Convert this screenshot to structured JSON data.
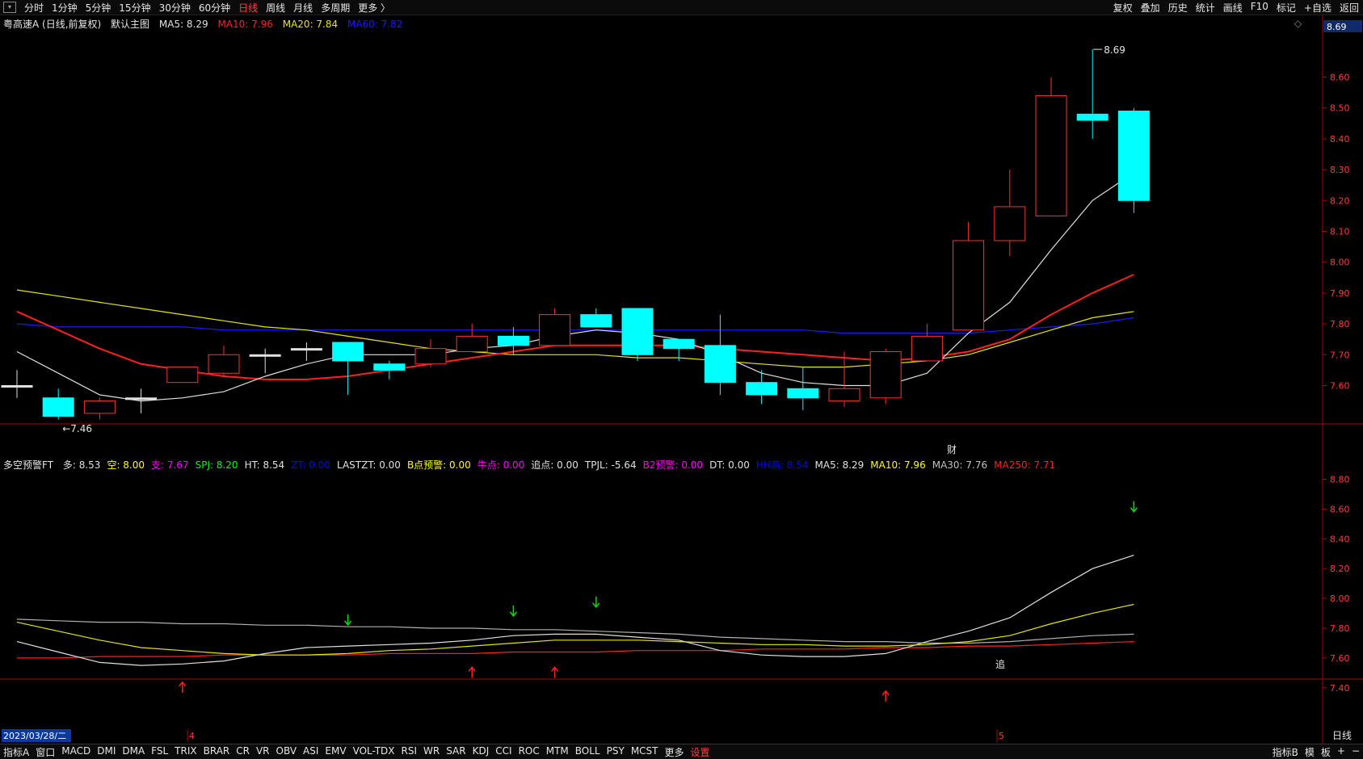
{
  "top_tabs": [
    "分时",
    "1分钟",
    "5分钟",
    "15分钟",
    "30分钟",
    "60分钟",
    "日线",
    "周线",
    "月线",
    "多周期",
    "更多 〉"
  ],
  "active_tab": "日线",
  "top_right": [
    "复权",
    "叠加",
    "历史",
    "统计",
    "画线",
    "F10",
    "标记",
    "+自选",
    "返回"
  ],
  "main_info": {
    "title": "粤高速A (日线,前复权)",
    "template": "默认主图",
    "ma5": "MA5: 8.29",
    "ma10": "MA10: 7.96",
    "ma20": "MA20: 7.84",
    "ma60": "MA60: 7.82"
  },
  "sub_info": {
    "name": "多空预警FT",
    "items": [
      {
        "t": "多: 8.53",
        "c": "#e0e0e0"
      },
      {
        "t": "空: 8.00",
        "c": "#ffff00"
      },
      {
        "t": "支: 7.67",
        "c": "#ff00ff"
      },
      {
        "t": "SPJ: 8.20",
        "c": "#00ff00"
      },
      {
        "t": "HT: 8.54",
        "c": "#e0e0e0"
      },
      {
        "t": "ZT: 0.00",
        "c": "#0000ff"
      },
      {
        "t": "LASTZT: 0.00",
        "c": "#e0e0e0"
      },
      {
        "t": "B点预警: 0.00",
        "c": "#ffff00"
      },
      {
        "t": "牛点: 0.00",
        "c": "#ff00ff"
      },
      {
        "t": "追点: 0.00",
        "c": "#e0e0e0"
      },
      {
        "t": "TPJL: -5.64",
        "c": "#e0e0e0"
      },
      {
        "t": "B2预警: 0.00",
        "c": "#ff00ff"
      },
      {
        "t": "DT: 0.00",
        "c": "#e0e0e0"
      },
      {
        "t": "HH高: 8.54",
        "c": "#0000ff"
      },
      {
        "t": "MA5: 8.29",
        "c": "#e0e0e0"
      },
      {
        "t": "MA10: 7.96",
        "c": "#ffff00"
      },
      {
        "t": "MA30: 7.76",
        "c": "#c0c0c0"
      },
      {
        "t": "MA250: 7.71",
        "c": "#ff2020"
      }
    ]
  },
  "labels": {
    "max": "8.69",
    "min": "7.46",
    "cai": "财",
    "zhui": "追",
    "date": "2023/03/28/二",
    "month4": "4",
    "month5": "5",
    "period": "日线",
    "price_current": "8.69"
  },
  "y_main_ticks": [
    "8.60",
    "8.50",
    "8.40",
    "8.30",
    "8.20",
    "8.10",
    "8.00",
    "7.90",
    "7.80",
    "7.70",
    "7.60"
  ],
  "y_sub_ticks": [
    "8.80",
    "8.60",
    "8.40",
    "8.20",
    "8.00",
    "7.80",
    "7.60",
    "7.40"
  ],
  "bottom_tabs": [
    "指标A",
    "窗口",
    "MACD",
    "DMI",
    "DMA",
    "FSL",
    "TRIX",
    "BRAR",
    "CR",
    "VR",
    "OBV",
    "ASI",
    "EMV",
    "VOL-TDX",
    "RSI",
    "WR",
    "SAR",
    "KDJ",
    "CCI",
    "ROC",
    "MTM",
    "BOLL",
    "PSY",
    "MCST",
    "更多",
    "设置"
  ],
  "bottom_right": [
    "指标B",
    "模",
    "板",
    "+",
    "−"
  ],
  "colors": {
    "up": "#ff3030",
    "down": "#00ffff",
    "ma5": "#e0e0e0",
    "ma10": "#ff2020",
    "ma20": "#e6e600",
    "ma60": "#1a1aff"
  },
  "chart_data": {
    "type": "candlestick",
    "candles": [
      {
        "o": 7.6,
        "h": 7.65,
        "l": 7.56,
        "c": 7.6
      },
      {
        "o": 7.56,
        "h": 7.59,
        "l": 7.49,
        "c": 7.5
      },
      {
        "o": 7.51,
        "h": 7.56,
        "l": 7.49,
        "c": 7.55
      },
      {
        "o": 7.56,
        "h": 7.59,
        "l": 7.51,
        "c": 7.56
      },
      {
        "o": 7.61,
        "h": 7.66,
        "l": 7.61,
        "c": 7.66
      },
      {
        "o": 7.64,
        "h": 7.73,
        "l": 7.63,
        "c": 7.7
      },
      {
        "o": 7.7,
        "h": 7.72,
        "l": 7.64,
        "c": 7.7
      },
      {
        "o": 7.72,
        "h": 7.74,
        "l": 7.68,
        "c": 7.72
      },
      {
        "o": 7.74,
        "h": 7.74,
        "l": 7.57,
        "c": 7.68
      },
      {
        "o": 7.67,
        "h": 7.68,
        "l": 7.62,
        "c": 7.65
      },
      {
        "o": 7.67,
        "h": 7.75,
        "l": 7.66,
        "c": 7.72
      },
      {
        "o": 7.71,
        "h": 7.8,
        "l": 7.71,
        "c": 7.76
      },
      {
        "o": 7.76,
        "h": 7.79,
        "l": 7.7,
        "c": 7.73
      },
      {
        "o": 7.73,
        "h": 7.85,
        "l": 7.73,
        "c": 7.83
      },
      {
        "o": 7.83,
        "h": 7.85,
        "l": 7.79,
        "c": 7.79
      },
      {
        "o": 7.85,
        "h": 7.85,
        "l": 7.68,
        "c": 7.7
      },
      {
        "o": 7.75,
        "h": 7.75,
        "l": 7.68,
        "c": 7.72
      },
      {
        "o": 7.73,
        "h": 7.83,
        "l": 7.57,
        "c": 7.61
      },
      {
        "o": 7.61,
        "h": 7.65,
        "l": 7.54,
        "c": 7.57
      },
      {
        "o": 7.59,
        "h": 7.66,
        "l": 7.52,
        "c": 7.56
      },
      {
        "o": 7.55,
        "h": 7.71,
        "l": 7.53,
        "c": 7.59
      },
      {
        "o": 7.56,
        "h": 7.72,
        "l": 7.54,
        "c": 7.71
      },
      {
        "o": 7.68,
        "h": 7.8,
        "l": 7.68,
        "c": 7.76
      },
      {
        "o": 7.78,
        "h": 8.13,
        "l": 7.78,
        "c": 8.07
      },
      {
        "o": 8.07,
        "h": 8.3,
        "l": 8.02,
        "c": 8.18
      },
      {
        "o": 8.15,
        "h": 8.6,
        "l": 8.15,
        "c": 8.54
      },
      {
        "o": 8.48,
        "h": 8.69,
        "l": 8.4,
        "c": 8.46
      },
      {
        "o": 8.49,
        "h": 8.5,
        "l": 8.16,
        "c": 8.2
      }
    ],
    "ma5": [
      7.71,
      7.64,
      7.57,
      7.55,
      7.56,
      7.58,
      7.63,
      7.67,
      7.7,
      7.7,
      7.7,
      7.72,
      7.73,
      7.76,
      7.78,
      7.77,
      7.75,
      7.7,
      7.64,
      7.61,
      7.6,
      7.6,
      7.64,
      7.77,
      7.87,
      8.04,
      8.2,
      8.29
    ],
    "ma10": [
      7.84,
      7.78,
      7.72,
      7.67,
      7.65,
      7.63,
      7.62,
      7.62,
      7.63,
      7.65,
      7.67,
      7.69,
      7.71,
      7.73,
      7.73,
      7.73,
      7.73,
      7.72,
      7.71,
      7.7,
      7.69,
      7.68,
      7.69,
      7.71,
      7.75,
      7.83,
      7.9,
      7.96
    ],
    "ma20": [
      7.91,
      7.89,
      7.87,
      7.85,
      7.83,
      7.81,
      7.79,
      7.78,
      7.76,
      7.74,
      7.72,
      7.71,
      7.7,
      7.7,
      7.7,
      7.69,
      7.69,
      7.68,
      7.67,
      7.66,
      7.66,
      7.67,
      7.68,
      7.7,
      7.74,
      7.78,
      7.82,
      7.84
    ],
    "ma60": [
      7.8,
      7.79,
      7.79,
      7.79,
      7.79,
      7.78,
      7.78,
      7.78,
      7.78,
      7.78,
      7.78,
      7.78,
      7.78,
      7.78,
      7.78,
      7.78,
      7.78,
      7.78,
      7.78,
      7.78,
      7.77,
      7.77,
      7.77,
      7.77,
      7.78,
      7.79,
      7.8,
      7.82
    ],
    "sub": {
      "white": [
        7.71,
        7.64,
        7.57,
        7.55,
        7.56,
        7.58,
        7.63,
        7.67,
        7.68,
        7.69,
        7.7,
        7.72,
        7.75,
        7.76,
        7.76,
        7.74,
        7.72,
        7.65,
        7.62,
        7.61,
        7.61,
        7.63,
        7.71,
        7.78,
        7.87,
        8.04,
        8.2,
        8.29
      ],
      "yellow": [
        7.84,
        7.78,
        7.72,
        7.67,
        7.65,
        7.63,
        7.62,
        7.62,
        7.63,
        7.65,
        7.66,
        7.68,
        7.7,
        7.72,
        7.72,
        7.72,
        7.71,
        7.7,
        7.69,
        7.69,
        7.68,
        7.68,
        7.69,
        7.71,
        7.75,
        7.83,
        7.9,
        7.96
      ],
      "gray": [
        7.86,
        7.85,
        7.84,
        7.84,
        7.83,
        7.83,
        7.82,
        7.82,
        7.81,
        7.81,
        7.8,
        7.8,
        7.79,
        7.79,
        7.78,
        7.77,
        7.76,
        7.74,
        7.73,
        7.72,
        7.71,
        7.71,
        7.7,
        7.7,
        7.71,
        7.73,
        7.75,
        7.76
      ],
      "red": [
        7.6,
        7.6,
        7.61,
        7.61,
        7.61,
        7.62,
        7.62,
        7.62,
        7.62,
        7.63,
        7.63,
        7.63,
        7.64,
        7.64,
        7.64,
        7.65,
        7.65,
        7.65,
        7.66,
        7.66,
        7.66,
        7.67,
        7.67,
        7.68,
        7.68,
        7.69,
        7.7,
        7.71
      ],
      "arrows": [
        {
          "i": 4,
          "v": 7.4,
          "dir": "up"
        },
        {
          "i": 8,
          "v": 7.86,
          "dir": "down"
        },
        {
          "i": 11,
          "v": 7.5,
          "dir": "up"
        },
        {
          "i": 12,
          "v": 7.92,
          "dir": "down"
        },
        {
          "i": 13,
          "v": 7.5,
          "dir": "up"
        },
        {
          "i": 14,
          "v": 7.98,
          "dir": "down"
        },
        {
          "i": 21,
          "v": 7.34,
          "dir": "up"
        },
        {
          "i": 27,
          "v": 8.62,
          "dir": "down"
        }
      ]
    }
  }
}
